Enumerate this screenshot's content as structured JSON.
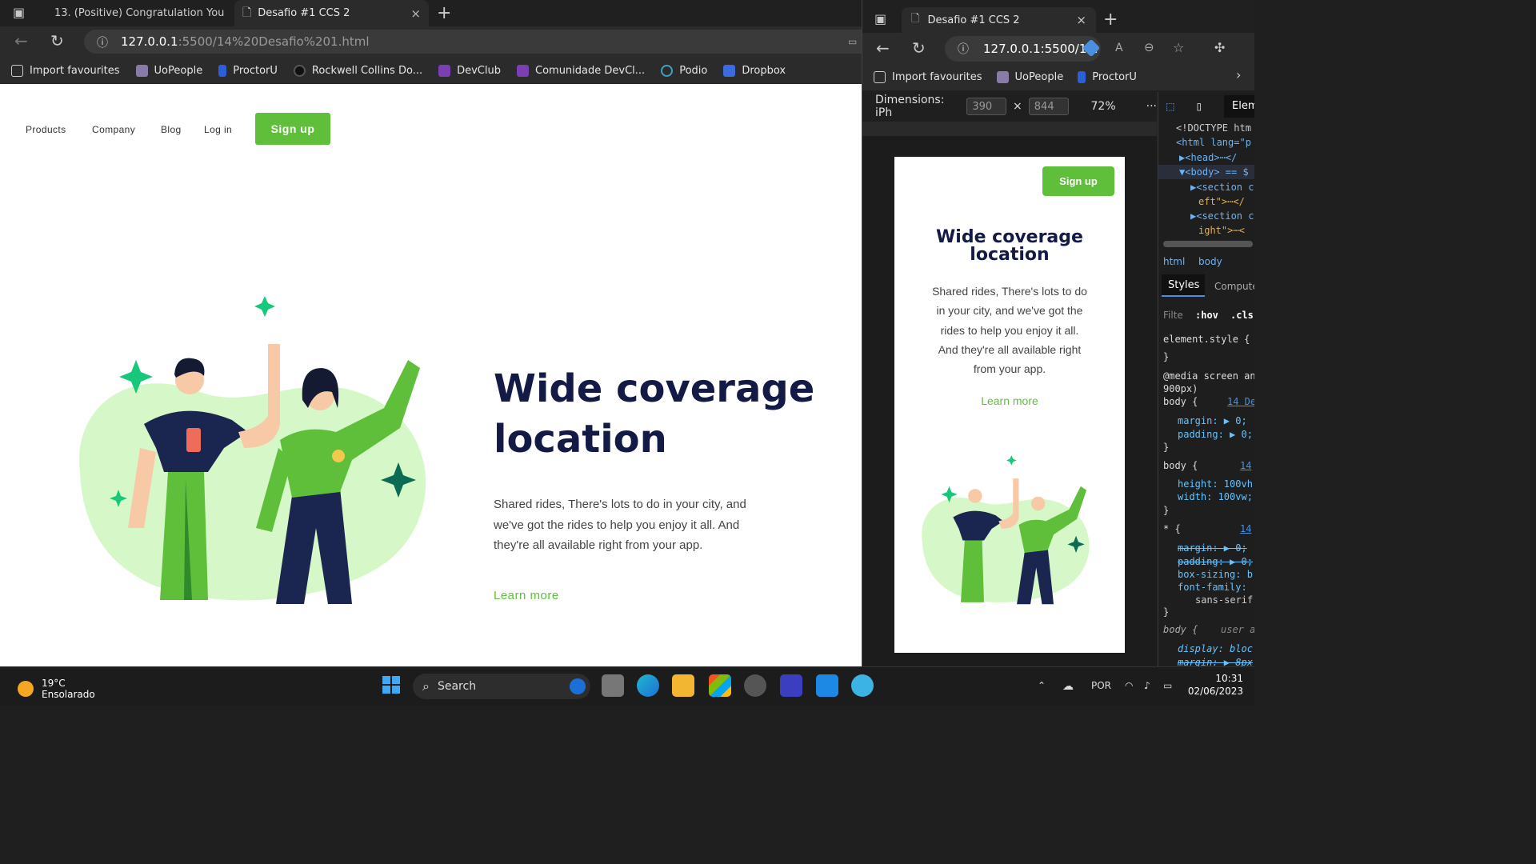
{
  "left_browser": {
    "tabs": [
      {
        "title": "13. (Positive) Congratulation You",
        "close": "×"
      },
      {
        "title": "Desafio #1 CCS 2",
        "close": "×"
      }
    ],
    "new_tab": "+",
    "url_host": "127.0.0.1",
    "url_rest": ":5500/14%20Desafio%201.html",
    "favourites": [
      "Import favourites",
      "UoPeople",
      "ProctorU",
      "Rockwell Collins Do...",
      "DevClub",
      "Comunidade DevCl...",
      "Podio",
      "Dropbox"
    ]
  },
  "page": {
    "nav": [
      "Products",
      "Company",
      "Blog",
      "Log in"
    ],
    "signup": "Sign up",
    "title_line1": "Wide coverage",
    "title_line2": "location",
    "text_line1": "Shared rides, There's lots to do in your city, and",
    "text_line2": "we've got the rides to help you enjoy it all. And",
    "text_line3": "they're all available right from your app.",
    "learn_more": "Learn more"
  },
  "right_browser": {
    "tab_title": "Desafio #1 CCS 2",
    "url": "127.0.0.1:5500/1...",
    "favourites": [
      "Import favourites",
      "UoPeople",
      "ProctorU"
    ],
    "dimensions_label": "Dimensions: iPh",
    "width": "390",
    "height": "844",
    "x": "×",
    "zoom": "72%",
    "more": "···"
  },
  "mobile": {
    "signup": "Sign up",
    "title_line1": "Wide coverage",
    "title_line2": "location",
    "text_line1": "Shared rides, There's lots to do",
    "text_line2": "in your city, and we've got the",
    "text_line3": "rides to help you enjoy it all.",
    "text_line4": "And they're all available right",
    "text_line5": "from your app.",
    "learn_more": "Learn more"
  },
  "devtools": {
    "elements_tab": "Elem",
    "doctype": "<!DOCTYPE htm",
    "html_line": "<html lang=\"p",
    "head_line": "▶<head>⋯</",
    "body_line": "▼<body> == $",
    "section1a": "▶<section c",
    "section1b": "eft\">⋯</",
    "section2a": "▶<section c",
    "section2b": "ight\">⋯<",
    "crumb_html": "html",
    "crumb_body": "body",
    "styles_tab": "Styles",
    "computed_tab": "Compute",
    "filter": "Filte",
    "hov": ":hov",
    "cls": ".cls",
    "element_style": "element.style {",
    "close_brace": "}",
    "media": "@media screen an",
    "media2": "900px)",
    "body_sel": "body {",
    "link1": "14 De",
    "margin_rule": "margin: ▶ 0;",
    "padding_rule": "padding: ▶ 0;",
    "link2": "14",
    "height_rule": "height: 100vh",
    "width_rule": "width: 100vw;",
    "star_sel": "* {",
    "margin_strike": "margin: ▶ 0;",
    "padding_strike": "padding: ▶ 0;",
    "boxsizing_rule": "box-sizing: b",
    "fontfamily_rule": "font-family:",
    "sans_serif": "sans-serif",
    "body_ua": "body {",
    "ua_label": "user a",
    "display_rule": "display: bloc",
    "margin_ua": "margin: ▶ 8px"
  },
  "taskbar": {
    "temperature": "19°C",
    "weather": "Ensolarado",
    "search": "Search",
    "language": "POR",
    "time": "10:31",
    "date": "02/06/2023"
  },
  "colors": {
    "accent_green": "#5fbf3b",
    "title_navy": "#131a46",
    "blob_green": "#d6f8c8"
  }
}
